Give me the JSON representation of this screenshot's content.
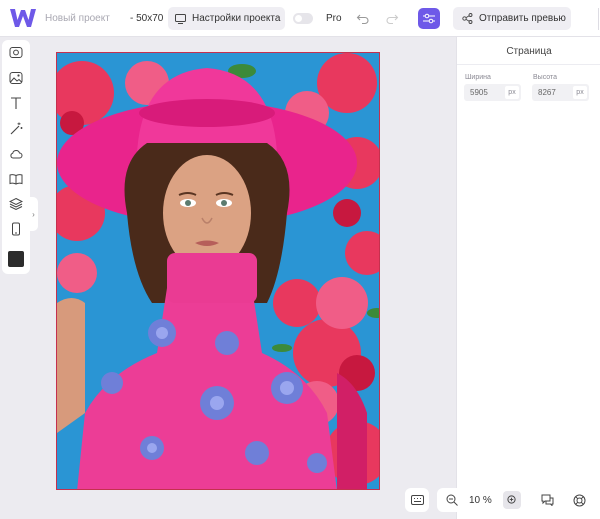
{
  "header": {
    "project_name": "Новый проект",
    "project_size": "- 50x70",
    "settings_label": "Настройки проекта",
    "pro_label": "Pro",
    "send_preview_label": "Отправить превью"
  },
  "colors": {
    "accent": "#6e59e8",
    "canvas_bg": "#ecebf0",
    "swatch": "#2c2c2c"
  },
  "toolbar": {
    "tools": [
      "camera-icon",
      "image-icon",
      "text-icon",
      "magic-wand-icon",
      "cloud-icon",
      "book-icon",
      "layers-icon",
      "phone-icon"
    ]
  },
  "panel": {
    "title": "Страница",
    "width_label": "Ширина",
    "width_value": "5905",
    "width_unit": "px",
    "height_label": "Высота",
    "height_value": "8267",
    "height_unit": "px"
  },
  "zoom": {
    "value": "10 %"
  }
}
